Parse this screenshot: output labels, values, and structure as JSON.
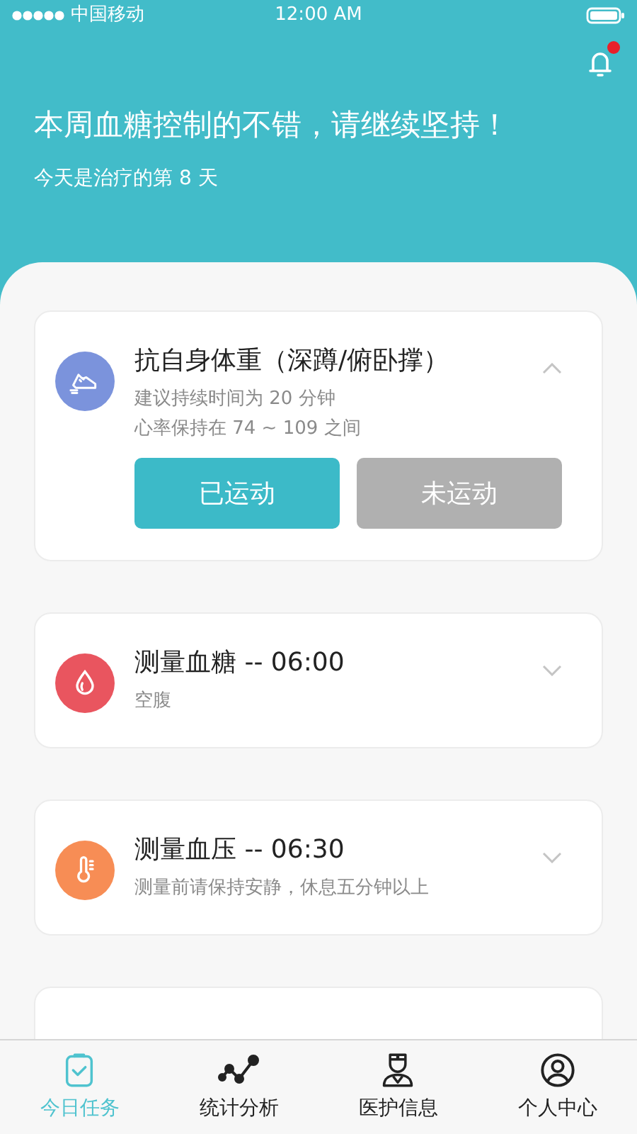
{
  "status_bar": {
    "carrier": "中国移动",
    "time": "12:00 AM"
  },
  "header": {
    "notification_badge": true,
    "title": "本周血糖控制的不错，请继续坚持！",
    "subtitle": "今天是治疗的第 8 天"
  },
  "tasks": [
    {
      "kind": "exercise",
      "color": "#7b93dc",
      "title": "抗自身体重（深蹲/俯卧撑）",
      "notes": [
        "建议持续时间为 20 分钟",
        "心率保持在 74 ~ 109 之间"
      ],
      "expanded": true,
      "buttons": [
        {
          "label": "已运动",
          "selected": true
        },
        {
          "label": "未运动",
          "selected": false
        }
      ]
    },
    {
      "kind": "glucose",
      "color": "#e9555f",
      "title": "测量血糖 -- 06:00",
      "notes": [
        "空腹"
      ],
      "expanded": false
    },
    {
      "kind": "pressure",
      "color": "#f78d55",
      "title": "测量血压 -- 06:30",
      "notes": [
        "测量前请保持安静，休息五分钟以上"
      ],
      "expanded": false
    }
  ],
  "tab_bar": [
    {
      "label": "今日任务",
      "selected": true
    },
    {
      "label": "统计分析",
      "selected": false
    },
    {
      "label": "医护信息",
      "selected": false
    },
    {
      "label": "个人中心",
      "selected": false
    }
  ]
}
